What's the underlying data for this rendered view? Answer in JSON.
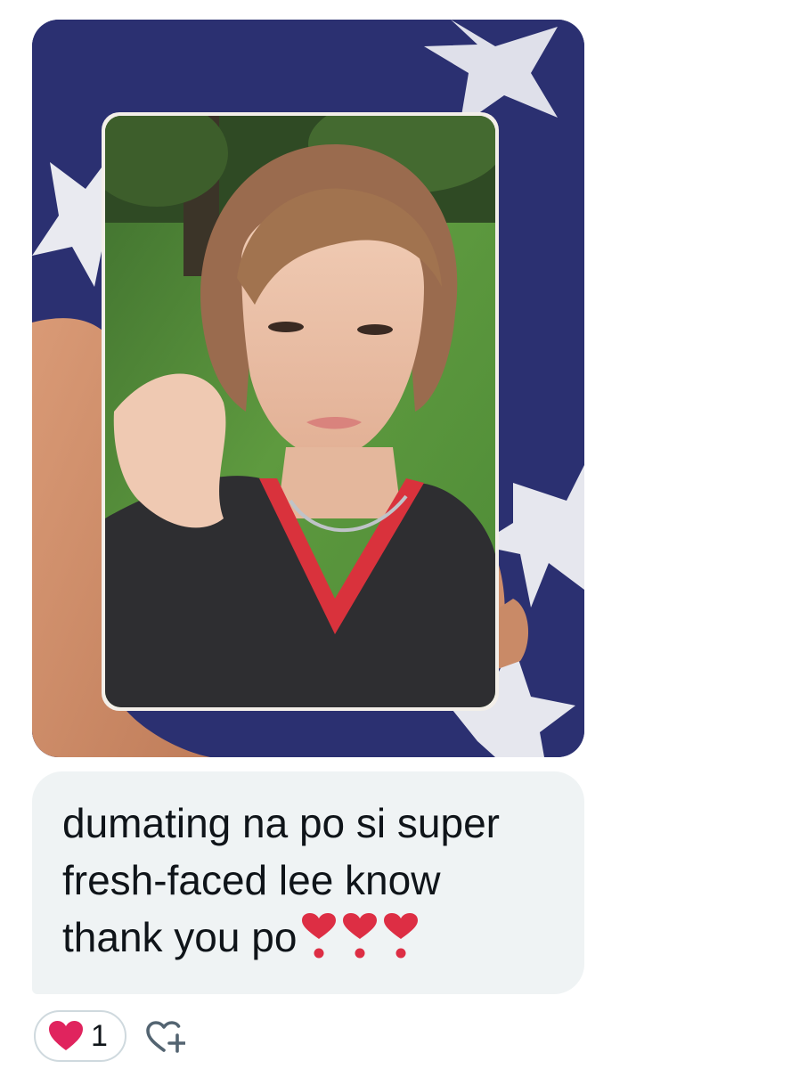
{
  "message": {
    "image": {
      "alt": "photocard held in hand"
    },
    "text_lines": [
      "dumating na po si super",
      "fresh-faced lee know",
      "thank you po"
    ],
    "emoji_suffix": [
      "heavy-heart-exclamation",
      "heavy-heart-exclamation",
      "heavy-heart-exclamation"
    ]
  },
  "reactions": {
    "heart_count": "1",
    "heart_icon": "red-heart-icon",
    "add_icon": "add-reaction-icon"
  },
  "colors": {
    "bubble_bg": "#eff3f4",
    "text": "#0f1419",
    "pill_border": "#cfd9de",
    "heart_red": "#e0245e",
    "emoji_red": "#dd2e44",
    "icon_gray": "#536471"
  }
}
